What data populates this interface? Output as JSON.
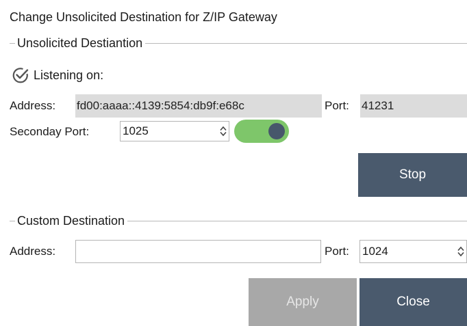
{
  "dialog": {
    "title": "Change Unsolicited Destination for Z/IP Gateway"
  },
  "unsolicited": {
    "group_title": "Unsolicited Destiantion",
    "listening_label": "Listening on:",
    "address_label": "Address:",
    "address_value": "fd00:aaaa::4139:5854:db9f:e68c",
    "port_label": "Port:",
    "port_value": "41231",
    "secondary_port_label": "Seconday Port:",
    "secondary_port_value": "1025",
    "toggle_on": true,
    "stop_label": "Stop"
  },
  "custom": {
    "group_title": "Custom Destination",
    "address_label": "Address:",
    "address_value": "",
    "port_label": "Port:",
    "port_value": "1024"
  },
  "buttons": {
    "apply_label": "Apply",
    "close_label": "Close"
  },
  "colors": {
    "accent_dark": "#4a5a6d",
    "toggle_on": "#7ec66a",
    "disabled": "#a8a8a8"
  }
}
